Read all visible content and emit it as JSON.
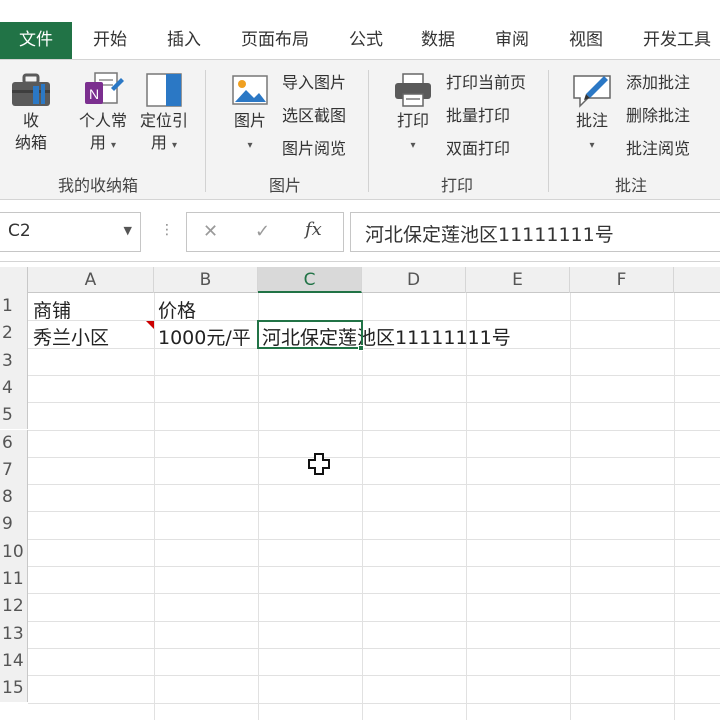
{
  "tabs": [
    {
      "label": "文件",
      "active": true
    },
    {
      "label": "开始"
    },
    {
      "label": "插入"
    },
    {
      "label": "页面布局"
    },
    {
      "label": "公式"
    },
    {
      "label": "数据"
    },
    {
      "label": "审阅"
    },
    {
      "label": "视图"
    },
    {
      "label": "开发工具"
    }
  ],
  "ribbon": {
    "storage": {
      "group_label": "我的收纳箱",
      "btn_storage_line1": "收",
      "btn_storage_line2": "纳箱",
      "btn_personal_line1": "个人常",
      "btn_personal_line2": "用",
      "btn_locate_line1": "定位引",
      "btn_locate_line2": "用"
    },
    "image": {
      "group_label": "图片",
      "btn_image": "图片",
      "import": "导入图片",
      "capture": "选区截图",
      "browse": "图片阅览"
    },
    "print": {
      "group_label": "打印",
      "btn_print": "打印",
      "print_current": "打印当前页",
      "batch": "批量打印",
      "duplex": "双面打印"
    },
    "comment": {
      "group_label": "批注",
      "btn_comment": "批注",
      "add": "添加批注",
      "delete": "删除批注",
      "browse": "批注阅览"
    }
  },
  "formula_bar": {
    "name_box": "C2",
    "cancel": "✕",
    "confirm": "✓",
    "fx": "fx",
    "value": "河北保定莲池区11111111号"
  },
  "sheet": {
    "columns": [
      "A",
      "B",
      "C",
      "D",
      "E",
      "F"
    ],
    "selected_column": "C",
    "rows": [
      "1",
      "2",
      "3",
      "4",
      "5",
      "6",
      "7",
      "8",
      "9",
      "10",
      "11",
      "12",
      "13",
      "14",
      "15"
    ],
    "cells": {
      "A1": "商铺",
      "B1": "价格",
      "A2": "秀兰小区",
      "B2": "1000元/平",
      "C2": "河北保定莲池区11111111号"
    },
    "accent_color": "#217346",
    "comment_color": "#cc0000"
  }
}
